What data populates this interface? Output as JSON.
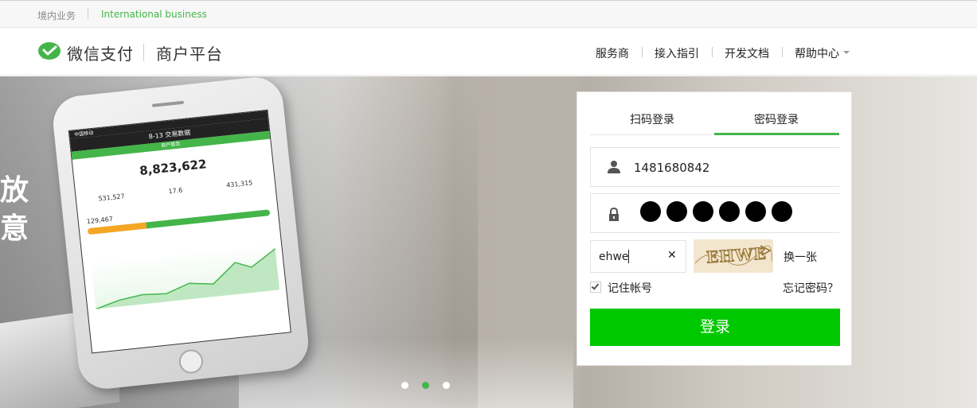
{
  "topbar": {
    "domestic": "境内业务",
    "international": "International business"
  },
  "header": {
    "brand": "微信支付",
    "product": "商户平台",
    "nav": [
      "服务商",
      "接入指引",
      "开发文档",
      "帮助中心"
    ]
  },
  "banner": {
    "char1": "放",
    "char2": "意",
    "phone": {
      "status": "中国移动",
      "title": "8-13 交易数据",
      "subtitle": "商户首页",
      "amount": "8,823,622",
      "stats": [
        "531,527",
        "17.6",
        "431,315"
      ],
      "progress_label": "129,467",
      "progress": {
        "orange": 0.32,
        "green": 0.68
      }
    },
    "carousel_active_index": 1
  },
  "login": {
    "tabs": [
      "扫码登录",
      "密码登录"
    ],
    "active_tab": 1,
    "account": "1481680842",
    "password_length": 6,
    "captcha_input": "ehwe",
    "clear_glyph": "✕",
    "captcha_image_text": "EHWE",
    "refresh": "换一张",
    "remember": "记住帐号",
    "remember_checked": true,
    "forgot": "忘记密码？",
    "submit": "登录"
  },
  "colors": {
    "brand_green": "#44b549",
    "button_green": "#00c800"
  }
}
